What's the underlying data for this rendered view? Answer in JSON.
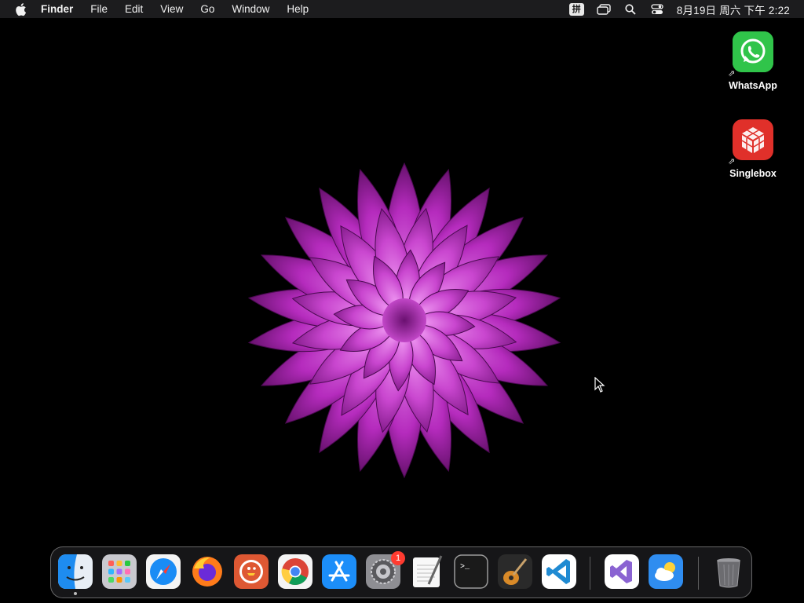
{
  "menubar": {
    "app_name": "Finder",
    "menus": [
      "File",
      "Edit",
      "View",
      "Go",
      "Window",
      "Help"
    ],
    "input_method": "拼",
    "clock": "8月19日 周六  下午 2:22"
  },
  "desktop_icons": [
    {
      "label": "WhatsApp",
      "icon": "whatsapp-icon"
    },
    {
      "label": "Singlebox",
      "icon": "singlebox-icon"
    }
  ],
  "dock": {
    "apps": [
      {
        "name": "finder",
        "icon": "finder-icon",
        "running": true
      },
      {
        "name": "launchpad",
        "icon": "launchpad-icon"
      },
      {
        "name": "safari",
        "icon": "safari-icon"
      },
      {
        "name": "firefox",
        "icon": "firefox-icon"
      },
      {
        "name": "duckduckgo",
        "icon": "duckduckgo-icon"
      },
      {
        "name": "chrome",
        "icon": "chrome-icon"
      },
      {
        "name": "app-store",
        "icon": "app-store-icon"
      },
      {
        "name": "system-settings",
        "icon": "gear-icon",
        "badge": "1"
      },
      {
        "name": "textedit",
        "icon": "textedit-icon"
      },
      {
        "name": "terminal",
        "icon": "terminal-icon"
      },
      {
        "name": "garageband",
        "icon": "guitar-icon"
      },
      {
        "name": "vscode",
        "icon": "vscode-icon"
      },
      {
        "name": "visual-studio",
        "icon": "visual-studio-icon"
      },
      {
        "name": "weather",
        "icon": "cloud-icon"
      },
      {
        "name": "trash",
        "icon": "trash-icon"
      }
    ]
  },
  "colors": {
    "flower": "#b02ab8",
    "menubar_bg": "#1c1c1e",
    "badge": "#ff3b30"
  }
}
